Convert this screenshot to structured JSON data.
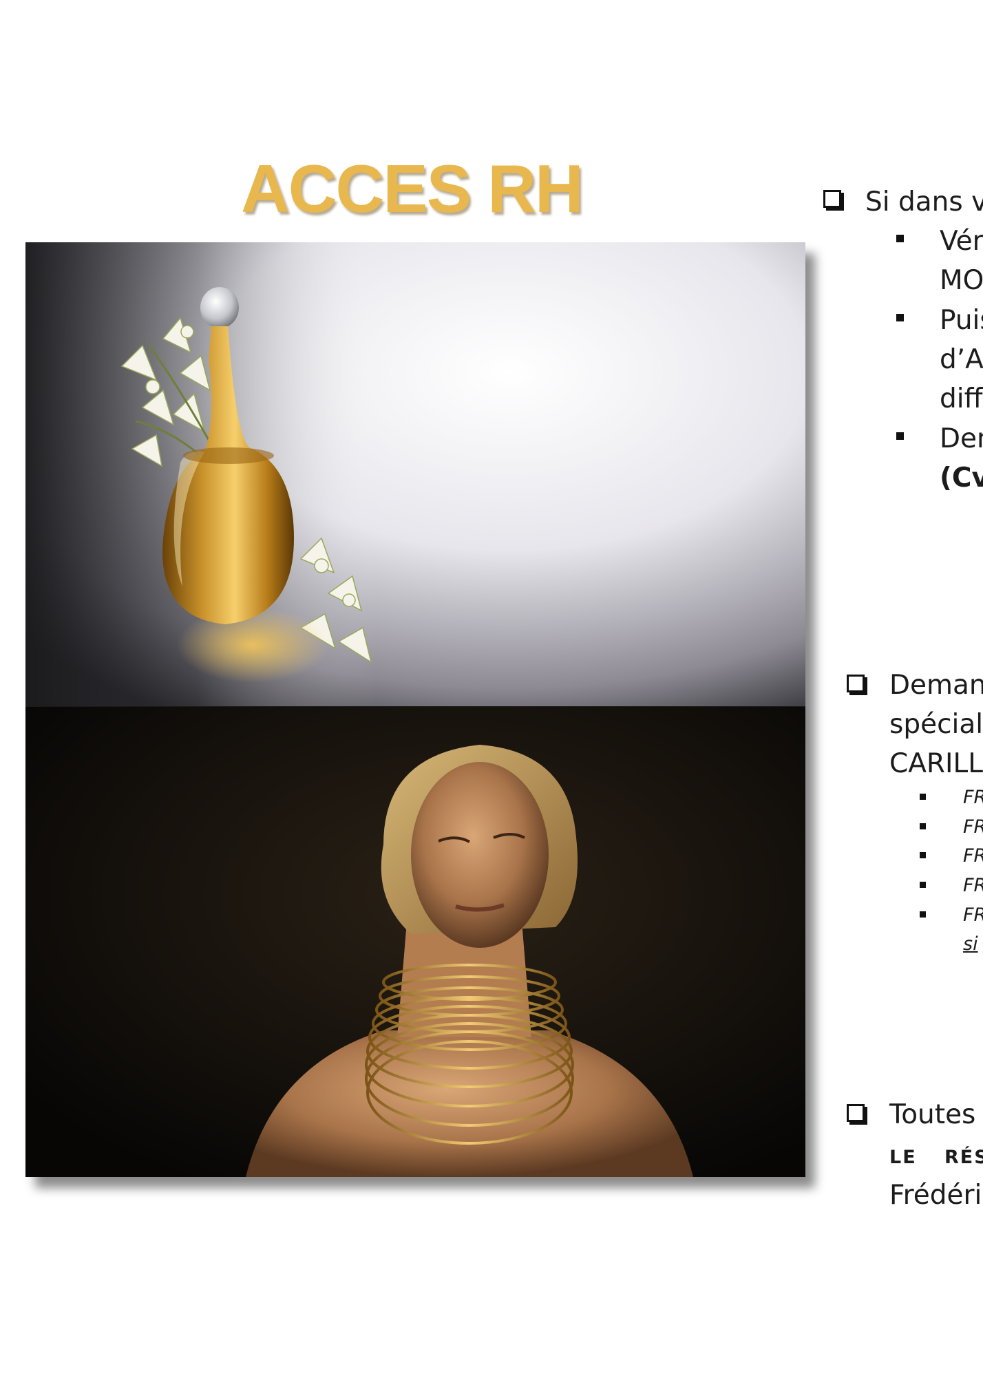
{
  "title": "ACCES RH",
  "section1": {
    "lead": "Si dans vo",
    "bullets": [
      {
        "lines": [
          "Vér",
          "MO"
        ]
      },
      {
        "lines": [
          "Puis",
          "d’Al",
          "diff"
        ]
      },
      {
        "lines": [
          "Den",
          "(Cv"
        ]
      }
    ]
  },
  "section2": {
    "lines": [
      "Deman",
      "spéciale",
      "CARILLO"
    ],
    "sub_bullets": [
      "FR",
      "FR",
      "FR",
      "FR",
      "FR"
    ],
    "sub_continuation": "si"
  },
  "section3": {
    "lead": "Toutes",
    "caps": [
      "LE",
      "RÉS"
    ],
    "last": "Frédéri"
  },
  "colors": {
    "title": "#e8b84f",
    "text": "#1c1c1c"
  },
  "images": [
    "perfume-bottle-photo",
    "gold-necklace-portrait-photo"
  ]
}
